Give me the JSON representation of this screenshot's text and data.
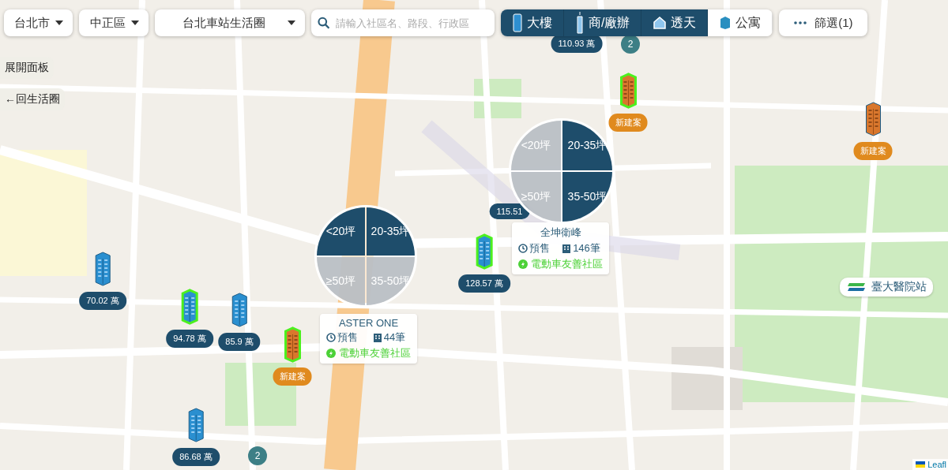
{
  "filters": {
    "dropdowns": [
      {
        "label": "台北市"
      },
      {
        "label": "中正區"
      },
      {
        "label": "台北車站生活圈"
      }
    ],
    "search": {
      "placeholder": "請輸入社區名、路段、行政區"
    },
    "types": [
      {
        "label": "大樓",
        "kind": "tower",
        "selected": true
      },
      {
        "label": "商/廠辦",
        "kind": "office",
        "selected": true
      },
      {
        "label": "透天",
        "kind": "house",
        "selected": true
      },
      {
        "label": "公寓",
        "kind": "apartment",
        "selected": false
      }
    ],
    "more": {
      "label": "篩選(1)"
    }
  },
  "side_buttons": [
    {
      "label": "展開面板"
    },
    {
      "label": "←回生活圈"
    }
  ],
  "markers": [
    {
      "kind": "price",
      "label": "110.93 萬"
    },
    {
      "kind": "cluster",
      "label": "2"
    },
    {
      "kind": "new",
      "highlighted": true,
      "label": "新建案"
    },
    {
      "kind": "new",
      "highlighted": false,
      "label": "新建案"
    },
    {
      "kind": "listing",
      "highlighted": false,
      "label": "70.02 萬"
    },
    {
      "kind": "listing",
      "highlighted": true,
      "label": "94.78 萬"
    },
    {
      "kind": "listing",
      "highlighted": false,
      "label": "85.9 萬"
    },
    {
      "kind": "new",
      "highlighted": true,
      "label": "新建案"
    },
    {
      "kind": "listing",
      "highlighted": false,
      "label": "86.68 萬"
    },
    {
      "kind": "cluster",
      "label": "2"
    },
    {
      "kind": "listing",
      "highlighted": true,
      "label": "128.57 萬"
    },
    {
      "kind": "price",
      "label": "115.51"
    }
  ],
  "dials": [
    {
      "options": [
        {
          "label": "<20坪",
          "selected": true
        },
        {
          "label": "20-35坪",
          "selected": true
        },
        {
          "label": "≥50坪",
          "selected": false
        },
        {
          "label": "35-50坪",
          "selected": false
        }
      ]
    },
    {
      "options": [
        {
          "label": "<20坪",
          "selected": false
        },
        {
          "label": "20-35坪",
          "selected": true
        },
        {
          "label": "≥50坪",
          "selected": false
        },
        {
          "label": "35-50坪",
          "selected": true
        }
      ]
    }
  ],
  "cards": [
    {
      "title": "ASTER ONE",
      "status": "預售",
      "count": "44筆",
      "tag": "電動車友善社區"
    },
    {
      "title": "全坤衛峰",
      "status": "預售",
      "count": "146筆",
      "tag": "電動車友善社區"
    }
  ],
  "station": {
    "label": "臺大醫院站"
  },
  "attribution": {
    "label": "Leafl"
  }
}
